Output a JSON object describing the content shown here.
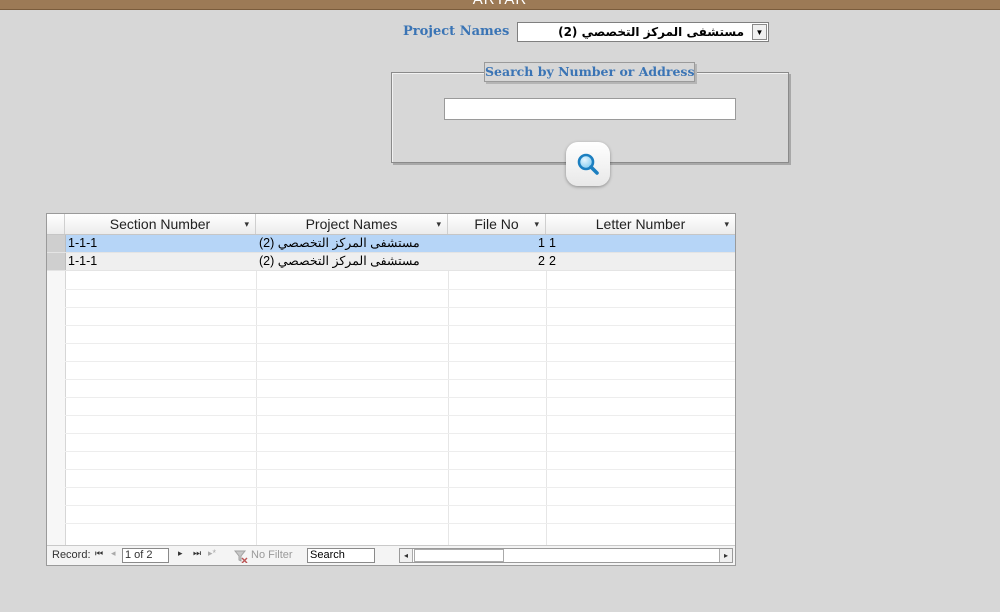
{
  "window": {
    "title": "ARTAR"
  },
  "project_filter": {
    "label": "Project Names",
    "selected": "مستشفى المركز التخصصي (2)",
    "dropdown_glyph": "▼"
  },
  "search": {
    "frame_title": "Search by Number or Address",
    "input_value": ""
  },
  "table": {
    "columns": [
      "Section Number",
      "Project Names",
      "File No",
      "Letter Number"
    ],
    "sort_glyph": "▾",
    "rows": [
      {
        "section": "1-1-1",
        "project": "مستشفى المركز التخصصي (2)",
        "file_no": "1",
        "letter": "1"
      },
      {
        "section": "1-1-1",
        "project": "مستشفى المركز التخصصي (2)",
        "file_no": "2",
        "letter": "2"
      }
    ]
  },
  "navigation": {
    "record_label": "Record:",
    "record_value": "1 of 2",
    "first": "⏮",
    "prev": "◂",
    "next": "▸",
    "last": "⏭",
    "new": "▸*",
    "no_filter": "No Filter",
    "search_label": "Search",
    "scroll_left": "◂",
    "scroll_right": "▸"
  },
  "colors": {
    "title_bar": "#9c7a56",
    "label_blue": "#3a74b5",
    "selected_row": "#b6d5f7"
  }
}
